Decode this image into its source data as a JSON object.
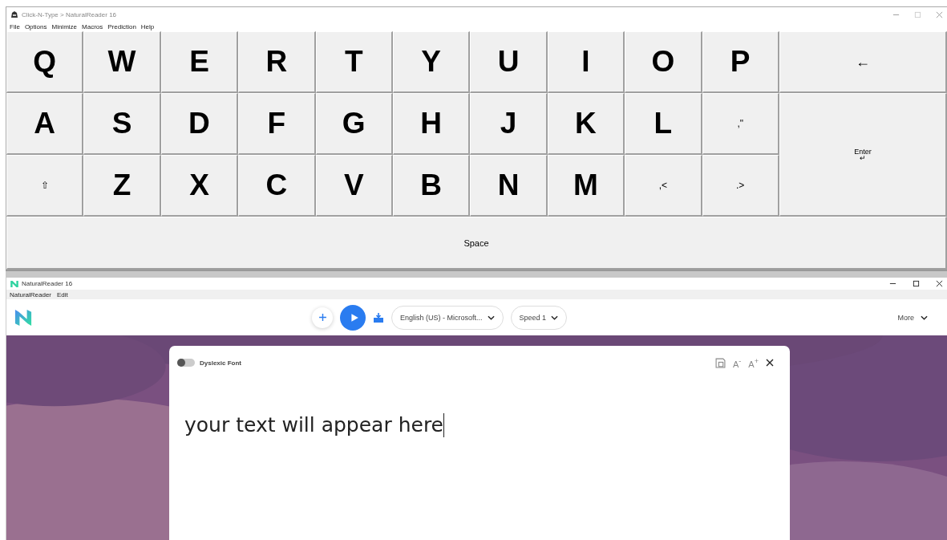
{
  "keyboard_window": {
    "title": "Click-N-Type > NaturalReader 16",
    "menu": [
      "File",
      "Options",
      "Minimize",
      "Macros",
      "Prediction",
      "Help"
    ],
    "rows": [
      [
        {
          "label": "Q",
          "kind": "letter"
        },
        {
          "label": "W",
          "kind": "letter"
        },
        {
          "label": "E",
          "kind": "letter"
        },
        {
          "label": "R",
          "kind": "letter"
        },
        {
          "label": "T",
          "kind": "letter"
        },
        {
          "label": "Y",
          "kind": "letter"
        },
        {
          "label": "U",
          "kind": "letter"
        },
        {
          "label": "I",
          "kind": "letter"
        },
        {
          "label": "O",
          "kind": "letter"
        },
        {
          "label": "P",
          "kind": "letter"
        }
      ],
      [
        {
          "label": "A",
          "kind": "letter"
        },
        {
          "label": "S",
          "kind": "letter"
        },
        {
          "label": "D",
          "kind": "letter"
        },
        {
          "label": "F",
          "kind": "letter"
        },
        {
          "label": "G",
          "kind": "letter"
        },
        {
          "label": "H",
          "kind": "letter"
        },
        {
          "label": "J",
          "kind": "letter"
        },
        {
          "label": "K",
          "kind": "letter"
        },
        {
          "label": "L",
          "kind": "letter"
        },
        {
          "label": ",\"",
          "kind": "symbol"
        }
      ],
      [
        {
          "label": "⇧",
          "kind": "symbol"
        },
        {
          "label": "Z",
          "kind": "letter"
        },
        {
          "label": "X",
          "kind": "letter"
        },
        {
          "label": "C",
          "kind": "letter"
        },
        {
          "label": "V",
          "kind": "letter"
        },
        {
          "label": "B",
          "kind": "letter"
        },
        {
          "label": "N",
          "kind": "letter"
        },
        {
          "label": "M",
          "kind": "letter"
        },
        {
          "label": ",<",
          "kind": "symbol"
        },
        {
          "label": ".>",
          "kind": "symbol"
        }
      ]
    ],
    "backspace": "←",
    "enter": {
      "label": "Enter",
      "glyph": "↵"
    },
    "space": "Space"
  },
  "reader_window": {
    "title": "NaturalReader 16",
    "menu": [
      "NaturalReader",
      "Edit"
    ],
    "voice": "English (US) - Microsoft...",
    "speed": "Speed 1",
    "more": "More",
    "editor": {
      "dyslexic_font": {
        "label": "Dyslexic Font",
        "on": false
      },
      "font_smaller": "A$^{-}$",
      "font_larger": "A$^{+}$",
      "text": "your text will appear here"
    }
  }
}
